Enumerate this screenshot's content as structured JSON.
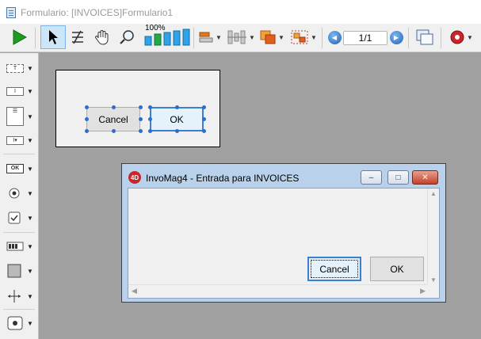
{
  "window": {
    "title": "Formulario: [INVOICES]Formulario1"
  },
  "toolbar": {
    "zoom_label": "100%",
    "page_indicator": "1/1",
    "icons": [
      "play-icon",
      "pointer-icon",
      "entry-order-icon",
      "hand-icon",
      "zoom-icon",
      "bar-sizes-icon",
      "object-order-icon",
      "align-icon",
      "group-icon",
      "distribute-icon",
      "prev-page-icon",
      "next-page-icon",
      "view-pages-icon",
      "settings-icon"
    ]
  },
  "palette": {
    "items": [
      "text-tool",
      "field-tool",
      "list-tool",
      "combo-tool",
      "button-tool",
      "radio-tool",
      "checkbox-tool",
      "progress-tool",
      "rectangle-tool",
      "line-tool",
      "web-area-tool"
    ],
    "button_tool_label": "OK",
    "text_tool_label": "T"
  },
  "design_form": {
    "cancel_label": "Cancel",
    "ok_label": "OK"
  },
  "dialog": {
    "title": "InvoMag4 - Entrada para INVOICES",
    "icon_label": "4D",
    "cancel_label": "Cancel",
    "ok_label": "OK",
    "minimize": "–",
    "maximize": "□",
    "close": "✕"
  },
  "colors": {
    "accent": "#3c7fd0",
    "dialog_frame": "#b9d1ea",
    "canvas": "#a0a0a0"
  }
}
